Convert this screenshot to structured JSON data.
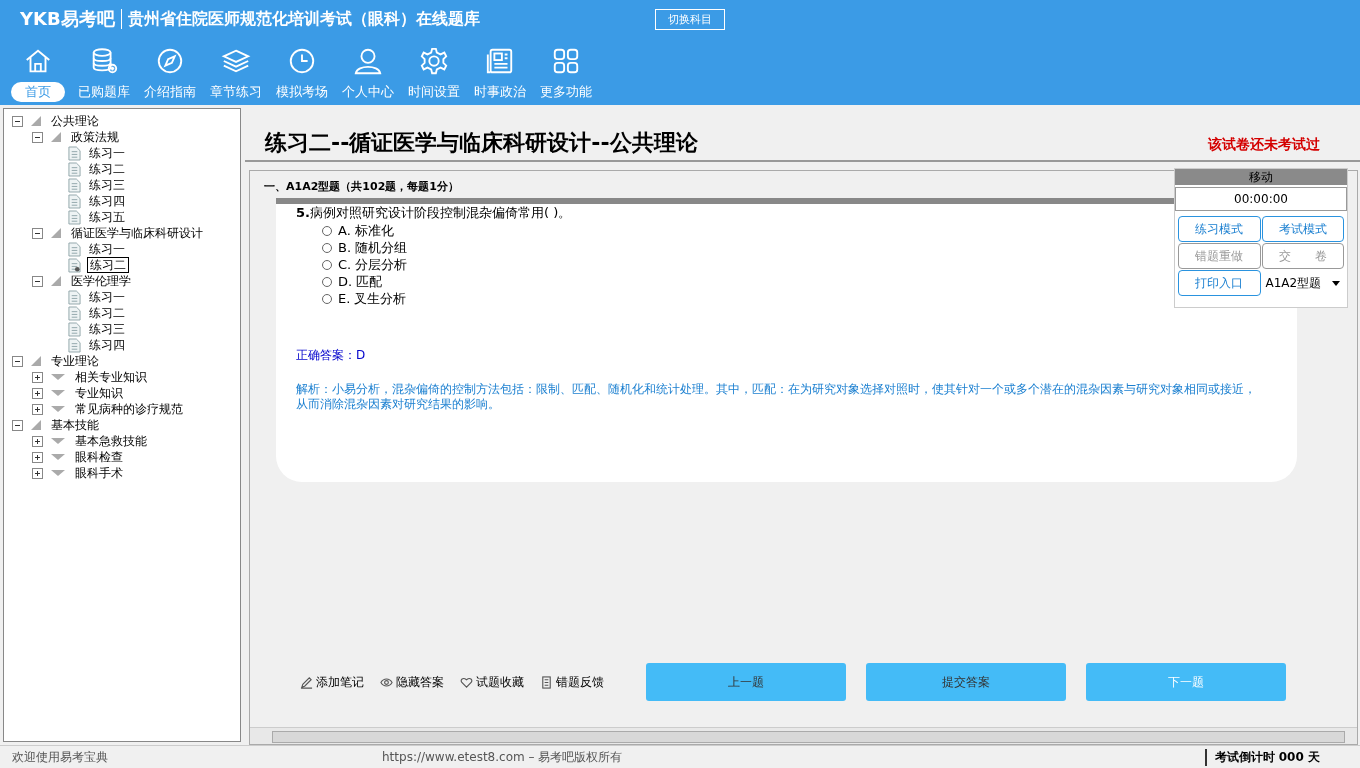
{
  "app": {
    "logo": "YKB易考吧",
    "title": "贵州省住院医师规范化培训考试（眼科）在线题库",
    "switch_button": "切换科目"
  },
  "nav": [
    {
      "label": "首页",
      "selected": true
    },
    {
      "label": "已购题库",
      "selected": false
    },
    {
      "label": "介绍指南",
      "selected": false
    },
    {
      "label": "章节练习",
      "selected": false
    },
    {
      "label": "模拟考场",
      "selected": false
    },
    {
      "label": "个人中心",
      "selected": false
    },
    {
      "label": "时间设置",
      "selected": false
    },
    {
      "label": "时事政治",
      "selected": false
    },
    {
      "label": "更多功能",
      "selected": false
    }
  ],
  "tree": [
    {
      "label": "公共理论",
      "kind": "folder",
      "expanded": true,
      "children": [
        {
          "label": "政策法规",
          "kind": "folder",
          "expanded": true,
          "children": [
            {
              "label": "练习一",
              "kind": "doc",
              "selected": false
            },
            {
              "label": "练习二",
              "kind": "doc",
              "selected": false
            },
            {
              "label": "练习三",
              "kind": "doc",
              "selected": false
            },
            {
              "label": "练习四",
              "kind": "doc",
              "selected": false
            },
            {
              "label": "练习五",
              "kind": "doc",
              "selected": false
            }
          ]
        },
        {
          "label": "循证医学与临床科研设计",
          "kind": "folder",
          "expanded": true,
          "children": [
            {
              "label": "练习一",
              "kind": "doc",
              "selected": false
            },
            {
              "label": "练习二",
              "kind": "doc",
              "selected": true
            }
          ]
        },
        {
          "label": "医学伦理学",
          "kind": "folder",
          "expanded": true,
          "children": [
            {
              "label": "练习一",
              "kind": "doc",
              "selected": false
            },
            {
              "label": "练习二",
              "kind": "doc",
              "selected": false
            },
            {
              "label": "练习三",
              "kind": "doc",
              "selected": false
            },
            {
              "label": "练习四",
              "kind": "doc",
              "selected": false
            }
          ]
        }
      ]
    },
    {
      "label": "专业理论",
      "kind": "folder",
      "expanded": true,
      "children": [
        {
          "label": "相关专业知识",
          "kind": "folder",
          "expanded": false
        },
        {
          "label": "专业知识",
          "kind": "folder",
          "expanded": false
        },
        {
          "label": "常见病种的诊疗规范",
          "kind": "folder",
          "expanded": false
        }
      ]
    },
    {
      "label": "基本技能",
      "kind": "folder",
      "expanded": true,
      "children": [
        {
          "label": "基本急救技能",
          "kind": "folder",
          "expanded": false
        },
        {
          "label": "眼科检查",
          "kind": "folder",
          "expanded": false
        },
        {
          "label": "眼科手术",
          "kind": "folder",
          "expanded": false
        }
      ]
    }
  ],
  "paper": {
    "title": "练习二--循证医学与临床科研设计--公共理论",
    "status": "该试卷还未考试过",
    "section": "一、A1A2型题（共102题，每题1分）"
  },
  "question": {
    "number": "5.",
    "text": "病例对照研究设计阶段控制混杂偏倚常用(  )。",
    "options": [
      {
        "letter": "A.",
        "text": "标准化",
        "selected": false
      },
      {
        "letter": "B.",
        "text": "随机分组",
        "selected": false
      },
      {
        "letter": "C.",
        "text": "分层分析",
        "selected": false
      },
      {
        "letter": "D.",
        "text": "匹配",
        "selected": false
      },
      {
        "letter": "E.",
        "text": "叉生分析",
        "selected": false
      }
    ],
    "answer": "正确答案：D",
    "analysis": "解析：小易分析，混杂偏倚的控制方法包括：限制、匹配、随机化和统计处理。其中，匹配：在为研究对象选择对照时，使其针对一个或多个潜在的混杂因素与研究对象相同或接近，从而消除混杂因素对研究结果的影响。"
  },
  "panel": {
    "header": "移动",
    "timer": "00:00:00",
    "buttons": [
      {
        "label": "练习模式",
        "disabled": false
      },
      {
        "label": "考试模式",
        "disabled": false
      },
      {
        "label": "错题重做",
        "disabled": true
      },
      {
        "label": "交　　卷",
        "disabled": true
      },
      {
        "label": "打印入口",
        "disabled": false
      }
    ],
    "type_select": "A1A2型题"
  },
  "tools": [
    "添加笔记",
    "隐藏答案",
    "试题收藏",
    "错题反馈"
  ],
  "actions": [
    "上一题",
    "提交答案",
    "下一题"
  ],
  "status_bar": {
    "welcome": "欢迎使用易考宝典",
    "copyright": "https://www.etest8.com – 易考吧版权所有",
    "countdown": "考试倒计时 000 天"
  }
}
